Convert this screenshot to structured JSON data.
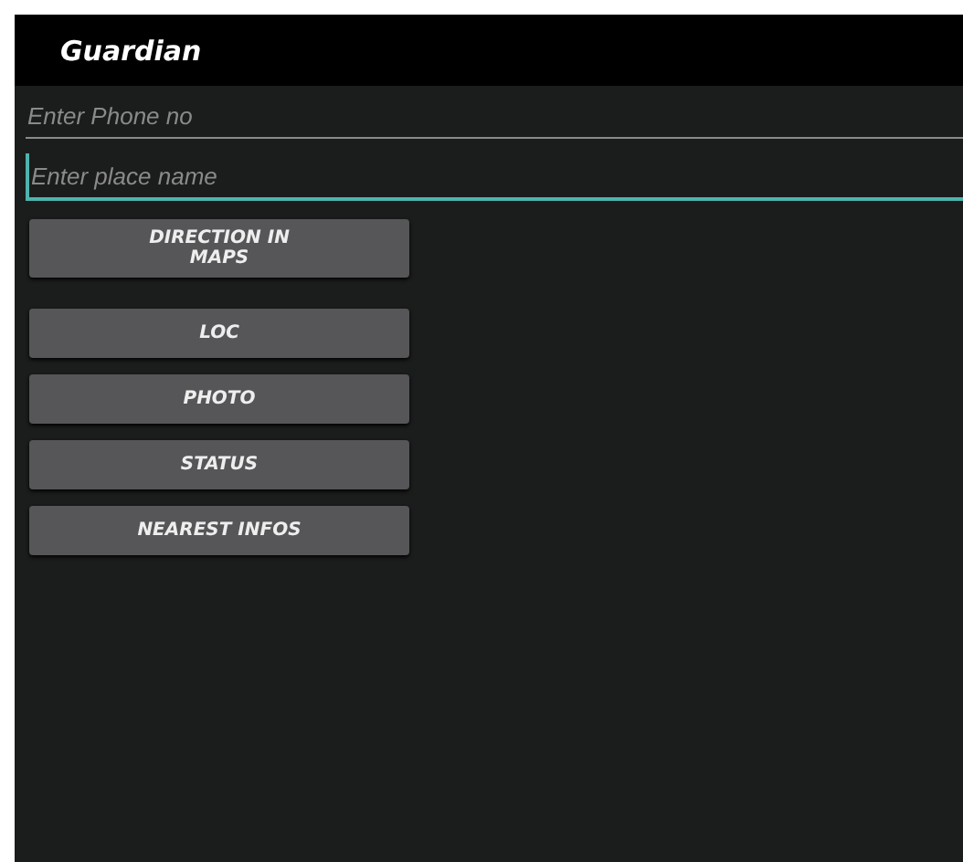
{
  "app_bar": {
    "title": "Guardian"
  },
  "fields": [
    {
      "placeholder": "Enter Phone no",
      "focused": false
    },
    {
      "placeholder": "Enter place name",
      "focused": true
    }
  ],
  "buttons": [
    {
      "label": "DIRECTION IN MAPS"
    },
    {
      "label": "LOC"
    },
    {
      "label": "PHOTO"
    },
    {
      "label": "STATUS"
    },
    {
      "label": "NEAREST INFOS"
    }
  ]
}
